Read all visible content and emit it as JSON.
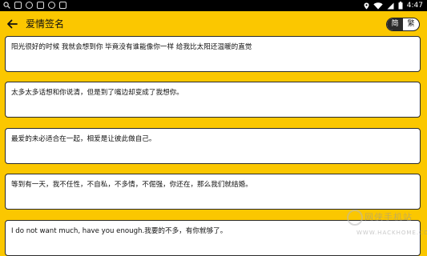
{
  "status_bar": {
    "time": "4:47",
    "left_icons": [
      "search-icon",
      "image-icon",
      "app-icon",
      "app-icon",
      "app-icon",
      "app-icon"
    ],
    "right_icons": [
      "location-icon",
      "wifi-icon",
      "signal-icon",
      "battery-icon"
    ]
  },
  "header": {
    "title": "爱情签名",
    "lang_simplified": "简",
    "lang_traditional": "繁"
  },
  "cards": [
    {
      "text": "阳光很好的时候 我就会想到你 毕竟没有谁能像你一样 给我比太阳还温暖的直觉"
    },
    {
      "text": "太多太多话想和你说清，但是到了嘴边却变成了我想你。"
    },
    {
      "text": "最爱的未必适合在一起，相爱是让彼此做自己。"
    },
    {
      "text": "等到有一天，我不任性，不自私，不多情，不倔强，你还在，那么我们就结婚。"
    },
    {
      "text": "I do not want much, have you enough.我要的不多，有你就够了。"
    }
  ],
  "watermark": {
    "name": "网侠手机站",
    "url": "WWW.HACKHOME.COM"
  },
  "colors": {
    "background": "#fbc700",
    "card": "#ffffff",
    "status_bar": "#000000"
  }
}
